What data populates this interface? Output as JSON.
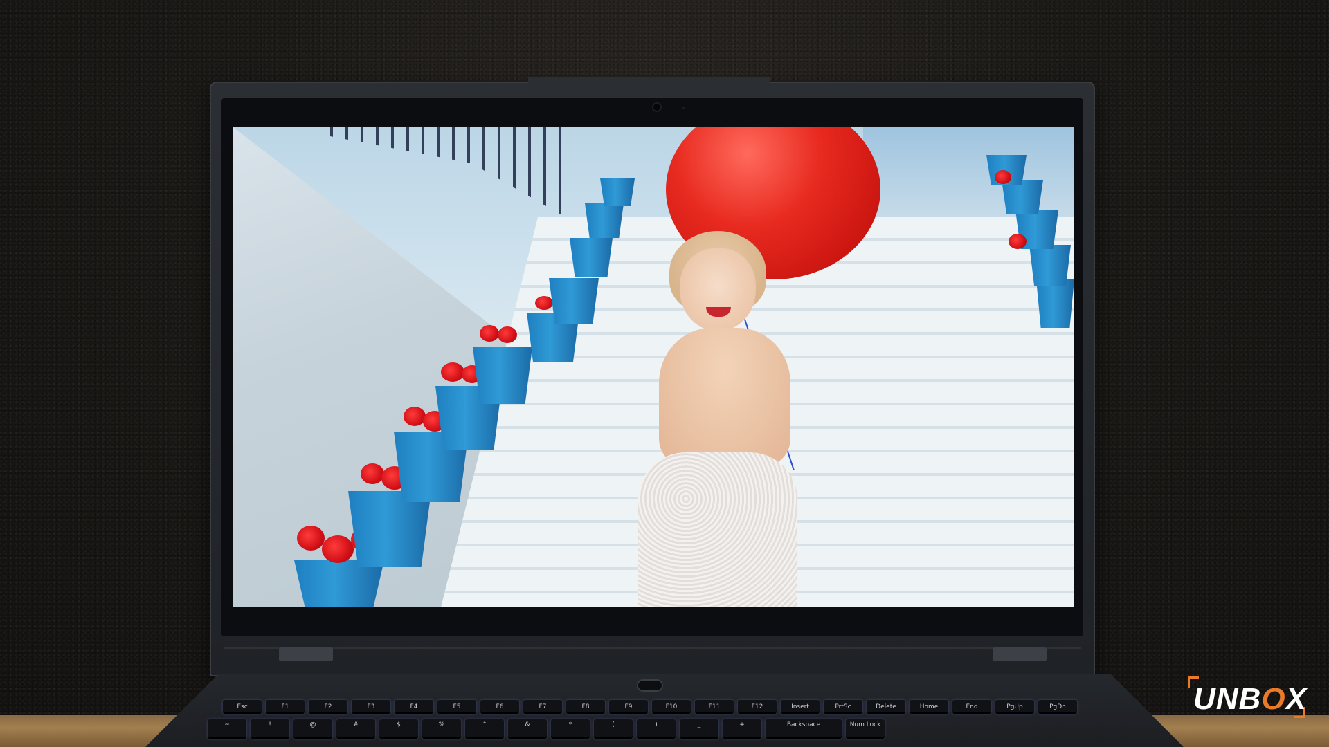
{
  "scene": {
    "description_label": "",
    "colors": {
      "balloon": "#e82a20",
      "pots": "#2f9ad6",
      "roses": "#d10f16",
      "accent_watermark": "#e97a2a"
    }
  },
  "keyboard": {
    "function_row": [
      "Esc",
      "F1",
      "F2",
      "F3",
      "F4",
      "F5",
      "F6",
      "F7",
      "F8",
      "F9",
      "F10",
      "F11",
      "F12",
      "Insert",
      "PrtSc",
      "Delete",
      "Home",
      "End",
      "PgUp",
      "PgDn"
    ],
    "number_row": [
      "~",
      "!",
      "@",
      "#",
      "$",
      "%",
      "^",
      "&",
      "*",
      "(",
      ")",
      "_",
      "+",
      "Backspace",
      "Num Lock"
    ]
  },
  "watermark": {
    "prefix": "UNB",
    "o_letter": "O",
    "suffix": "X"
  }
}
